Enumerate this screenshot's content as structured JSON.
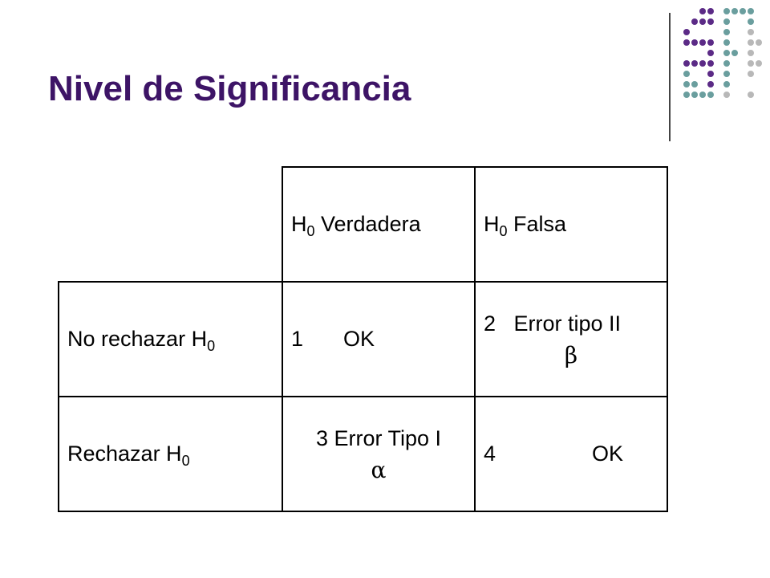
{
  "slide": {
    "title": "Nivel de Significancia"
  },
  "table": {
    "header": {
      "col2_main": "H",
      "col2_sub": "0",
      "col2_rest": " Verdadera",
      "col3_main": "H",
      "col3_sub": "0",
      "col3_rest": " Falsa"
    },
    "row1": {
      "label_main": "No rechazar H",
      "label_sub": "0",
      "cell2_num": "1",
      "cell2_text": "OK",
      "cell3_line1": "2   Error tipo II",
      "cell3_symbol": "β"
    },
    "row2": {
      "label_main": "Rechazar H",
      "label_sub": "0",
      "cell2_line1": "3 Error Tipo I",
      "cell2_symbol": "α",
      "cell3_num": "4",
      "cell3_text": "OK"
    }
  },
  "colors": {
    "title": "#3d1466",
    "logo_purple": "#5b2a86",
    "logo_teal": "#6a9e9e",
    "logo_gray": "#b8b8b8"
  }
}
